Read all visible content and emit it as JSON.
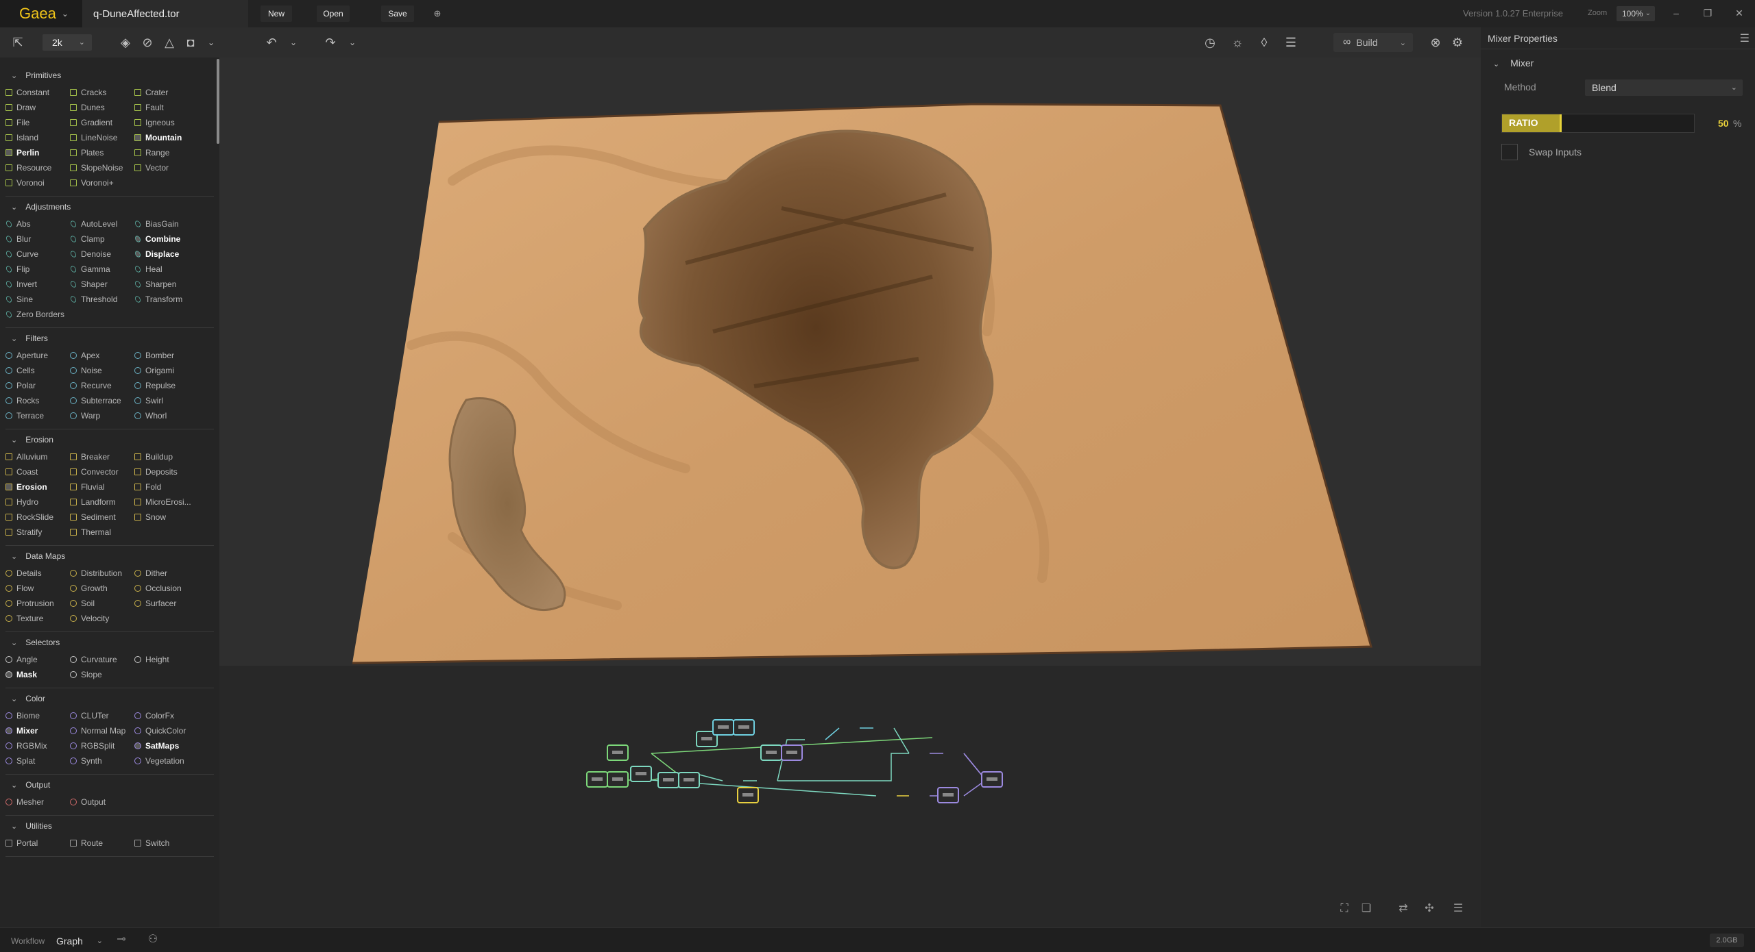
{
  "app": {
    "name": "Gaea",
    "file_name": "q-DuneAffected.tor",
    "version": "Version 1.0.27 Enterprise"
  },
  "menu": {
    "new": "New",
    "open": "Open",
    "save": "Save"
  },
  "zoom": {
    "label": "Zoom",
    "value": "100%"
  },
  "toolbar": {
    "resolution": "2k",
    "build_label": "Build"
  },
  "library": [
    {
      "name": "Primitives",
      "marker": "sq",
      "nodes": [
        [
          "Constant",
          "Cracks",
          "Crater"
        ],
        [
          "Draw",
          "Dunes",
          "Fault"
        ],
        [
          "File",
          "Gradient",
          "Igneous"
        ],
        [
          "Island",
          "LineNoise",
          "Mountain"
        ],
        [
          "Perlin",
          "Plates",
          "Range"
        ],
        [
          "Resource",
          "SlopeNoise",
          "Vector"
        ],
        [
          "Voronoi",
          "Voronoi+"
        ]
      ],
      "bold": [
        "Mountain",
        "Perlin"
      ]
    },
    {
      "name": "Adjustments",
      "marker": "ov",
      "nodes": [
        [
          "Abs",
          "AutoLevel",
          "BiasGain"
        ],
        [
          "Blur",
          "Clamp",
          "Combine"
        ],
        [
          "Curve",
          "Denoise",
          "Displace"
        ],
        [
          "Flip",
          "Gamma",
          "Heal"
        ],
        [
          "Invert",
          "Shaper",
          "Sharpen"
        ],
        [
          "Sine",
          "Threshold",
          "Transform"
        ],
        [
          "Zero Borders"
        ]
      ],
      "bold": [
        "Combine",
        "Displace"
      ]
    },
    {
      "name": "Filters",
      "marker": "ci",
      "nodes": [
        [
          "Aperture",
          "Apex",
          "Bomber"
        ],
        [
          "Cells",
          "Noise",
          "Origami"
        ],
        [
          "Polar",
          "Recurve",
          "Repulse"
        ],
        [
          "Rocks",
          "Subterrace",
          "Swirl"
        ],
        [
          "Terrace",
          "Warp",
          "Whorl"
        ]
      ],
      "bold": []
    },
    {
      "name": "Erosion",
      "marker": "sqy",
      "nodes": [
        [
          "Alluvium",
          "Breaker",
          "Buildup"
        ],
        [
          "Coast",
          "Convector",
          "Deposits"
        ],
        [
          "Erosion",
          "Fluvial",
          "Fold"
        ],
        [
          "Hydro",
          "Landform",
          "MicroErosi..."
        ],
        [
          "RockSlide",
          "Sediment",
          "Snow"
        ],
        [
          "Stratify",
          "Thermal"
        ]
      ],
      "bold": [
        "Erosion"
      ]
    },
    {
      "name": "Data Maps",
      "marker": "ciy",
      "nodes": [
        [
          "Details",
          "Distribution",
          "Dither"
        ],
        [
          "Flow",
          "Growth",
          "Occlusion"
        ],
        [
          "Protrusion",
          "Soil",
          "Surfacer"
        ],
        [
          "Texture",
          "Velocity"
        ]
      ],
      "bold": []
    },
    {
      "name": "Selectors",
      "marker": "cig",
      "nodes": [
        [
          "Angle",
          "Curvature",
          "Height"
        ],
        [
          "Mask",
          "Slope"
        ]
      ],
      "bold": [
        "Mask"
      ]
    },
    {
      "name": "Color",
      "marker": "cip",
      "nodes": [
        [
          "Biome",
          "CLUTer",
          "ColorFx"
        ],
        [
          "Mixer",
          "Normal Map",
          "QuickColor"
        ],
        [
          "RGBMix",
          "RGBSplit",
          "SatMaps"
        ],
        [
          "Splat",
          "Synth",
          "Vegetation"
        ]
      ],
      "bold": [
        "Mixer",
        "SatMaps"
      ]
    },
    {
      "name": "Output",
      "marker": "cir",
      "nodes": [
        [
          "Mesher",
          "Output"
        ]
      ],
      "bold": []
    },
    {
      "name": "Utilities",
      "marker": "sqg",
      "nodes": [
        [
          "Portal",
          "Route",
          "Switch"
        ]
      ],
      "bold": []
    }
  ],
  "properties": {
    "title": "Mixer Properties",
    "section": "Mixer",
    "method_label": "Method",
    "method_value": "Blend",
    "ratio_label": "RATIO",
    "ratio_value": 50,
    "ratio_unit": "%",
    "swap_label": "Swap Inputs"
  },
  "graph_nodes": [
    {
      "color": "#7dd87a"
    },
    {
      "color": "#7dd87a"
    },
    {
      "color": "#7dd87a"
    },
    {
      "color": "#7dd8c0"
    },
    {
      "color": "#7dd8c0"
    },
    {
      "color": "#7dd8c0"
    },
    {
      "color": "#7dd8c0"
    },
    {
      "color": "#6fd0e0"
    },
    {
      "color": "#6fd0e0"
    },
    {
      "color": "#7dd8c0"
    },
    {
      "color": "#9c8ae0"
    },
    {
      "color": "#9c8ae0"
    },
    {
      "color": "#e8d040"
    },
    {
      "color": "#9c8ae0"
    }
  ],
  "status": {
    "workflow_label": "Workflow",
    "workflow_value": "Graph",
    "memory": "2.0GB"
  }
}
